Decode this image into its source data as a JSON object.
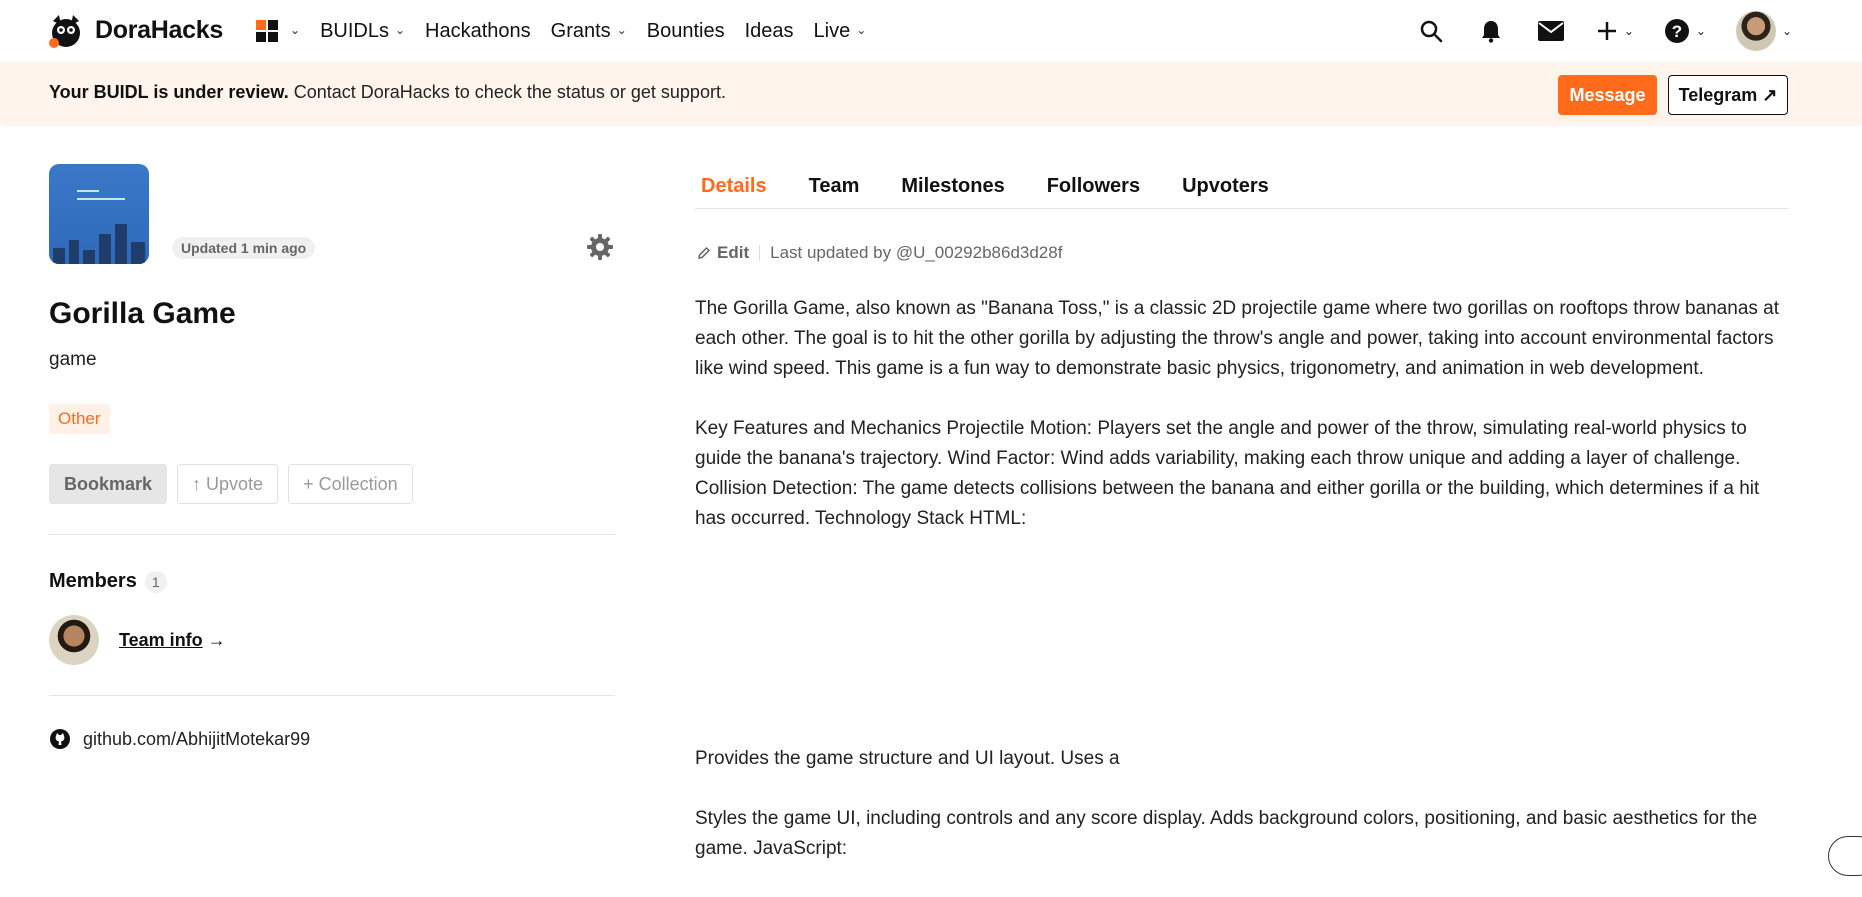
{
  "nav": {
    "logo_text": "DoraHacks",
    "items": [
      {
        "label": "BUIDLs",
        "has_dropdown": true
      },
      {
        "label": "Hackathons",
        "has_dropdown": false
      },
      {
        "label": "Grants",
        "has_dropdown": true
      },
      {
        "label": "Bounties",
        "has_dropdown": false
      },
      {
        "label": "Ideas",
        "has_dropdown": false
      },
      {
        "label": "Live",
        "has_dropdown": true
      }
    ],
    "right_icons": [
      "search-icon",
      "bell-icon",
      "mail-icon",
      "plus-icon",
      "help-icon",
      "avatar"
    ]
  },
  "banner": {
    "bold_text": "Your BUIDL is under review.",
    "text": " Contact DoraHacks to check the status or get support.",
    "message_button": "Message",
    "telegram_button": "Telegram ↗"
  },
  "project": {
    "updated": "Updated 1 min ago",
    "title": "Gorilla Game",
    "subtitle": "game",
    "tag": "Other",
    "buttons": {
      "bookmark": "Bookmark",
      "upvote": "↑ Upvote",
      "collection": "+ Collection"
    },
    "members_label": "Members",
    "members_count": "1",
    "team_info_link": "Team info",
    "team_info_arrow": " →",
    "github": "github.com/AbhijitMotekar99"
  },
  "tabs": [
    "Details",
    "Team",
    "Milestones",
    "Followers",
    "Upvoters"
  ],
  "details": {
    "edit_label": "Edit",
    "last_updated": "Last updated by @U_00292b86d3d28f",
    "paragraphs": [
      "The Gorilla Game, also known as \"Banana Toss,\" is a classic 2D projectile game where two gorillas on rooftops throw bananas at each other. The goal is to hit the other gorilla by adjusting the throw's angle and power, taking into account environmental factors like wind speed. This game is a fun way to demonstrate basic physics, trigonometry, and animation in web development.",
      "Key Features and Mechanics Projectile Motion: Players set the angle and power of the throw, simulating real-world physics to guide the banana's trajectory. Wind Factor: Wind adds variability, making each throw unique and adding a layer of challenge. Collision Detection: The game detects collisions between the banana and either gorilla or the building, which determines if a hit has occurred. Technology Stack HTML:",
      "Provides the game structure and UI layout. Uses a",
      "Styles the game UI, including controls and any score display. Adds background colors, positioning, and basic aesthetics for the game. JavaScript:"
    ]
  },
  "colors": {
    "accent": "#ff6b1a",
    "banner_bg": "#fff4ec"
  }
}
